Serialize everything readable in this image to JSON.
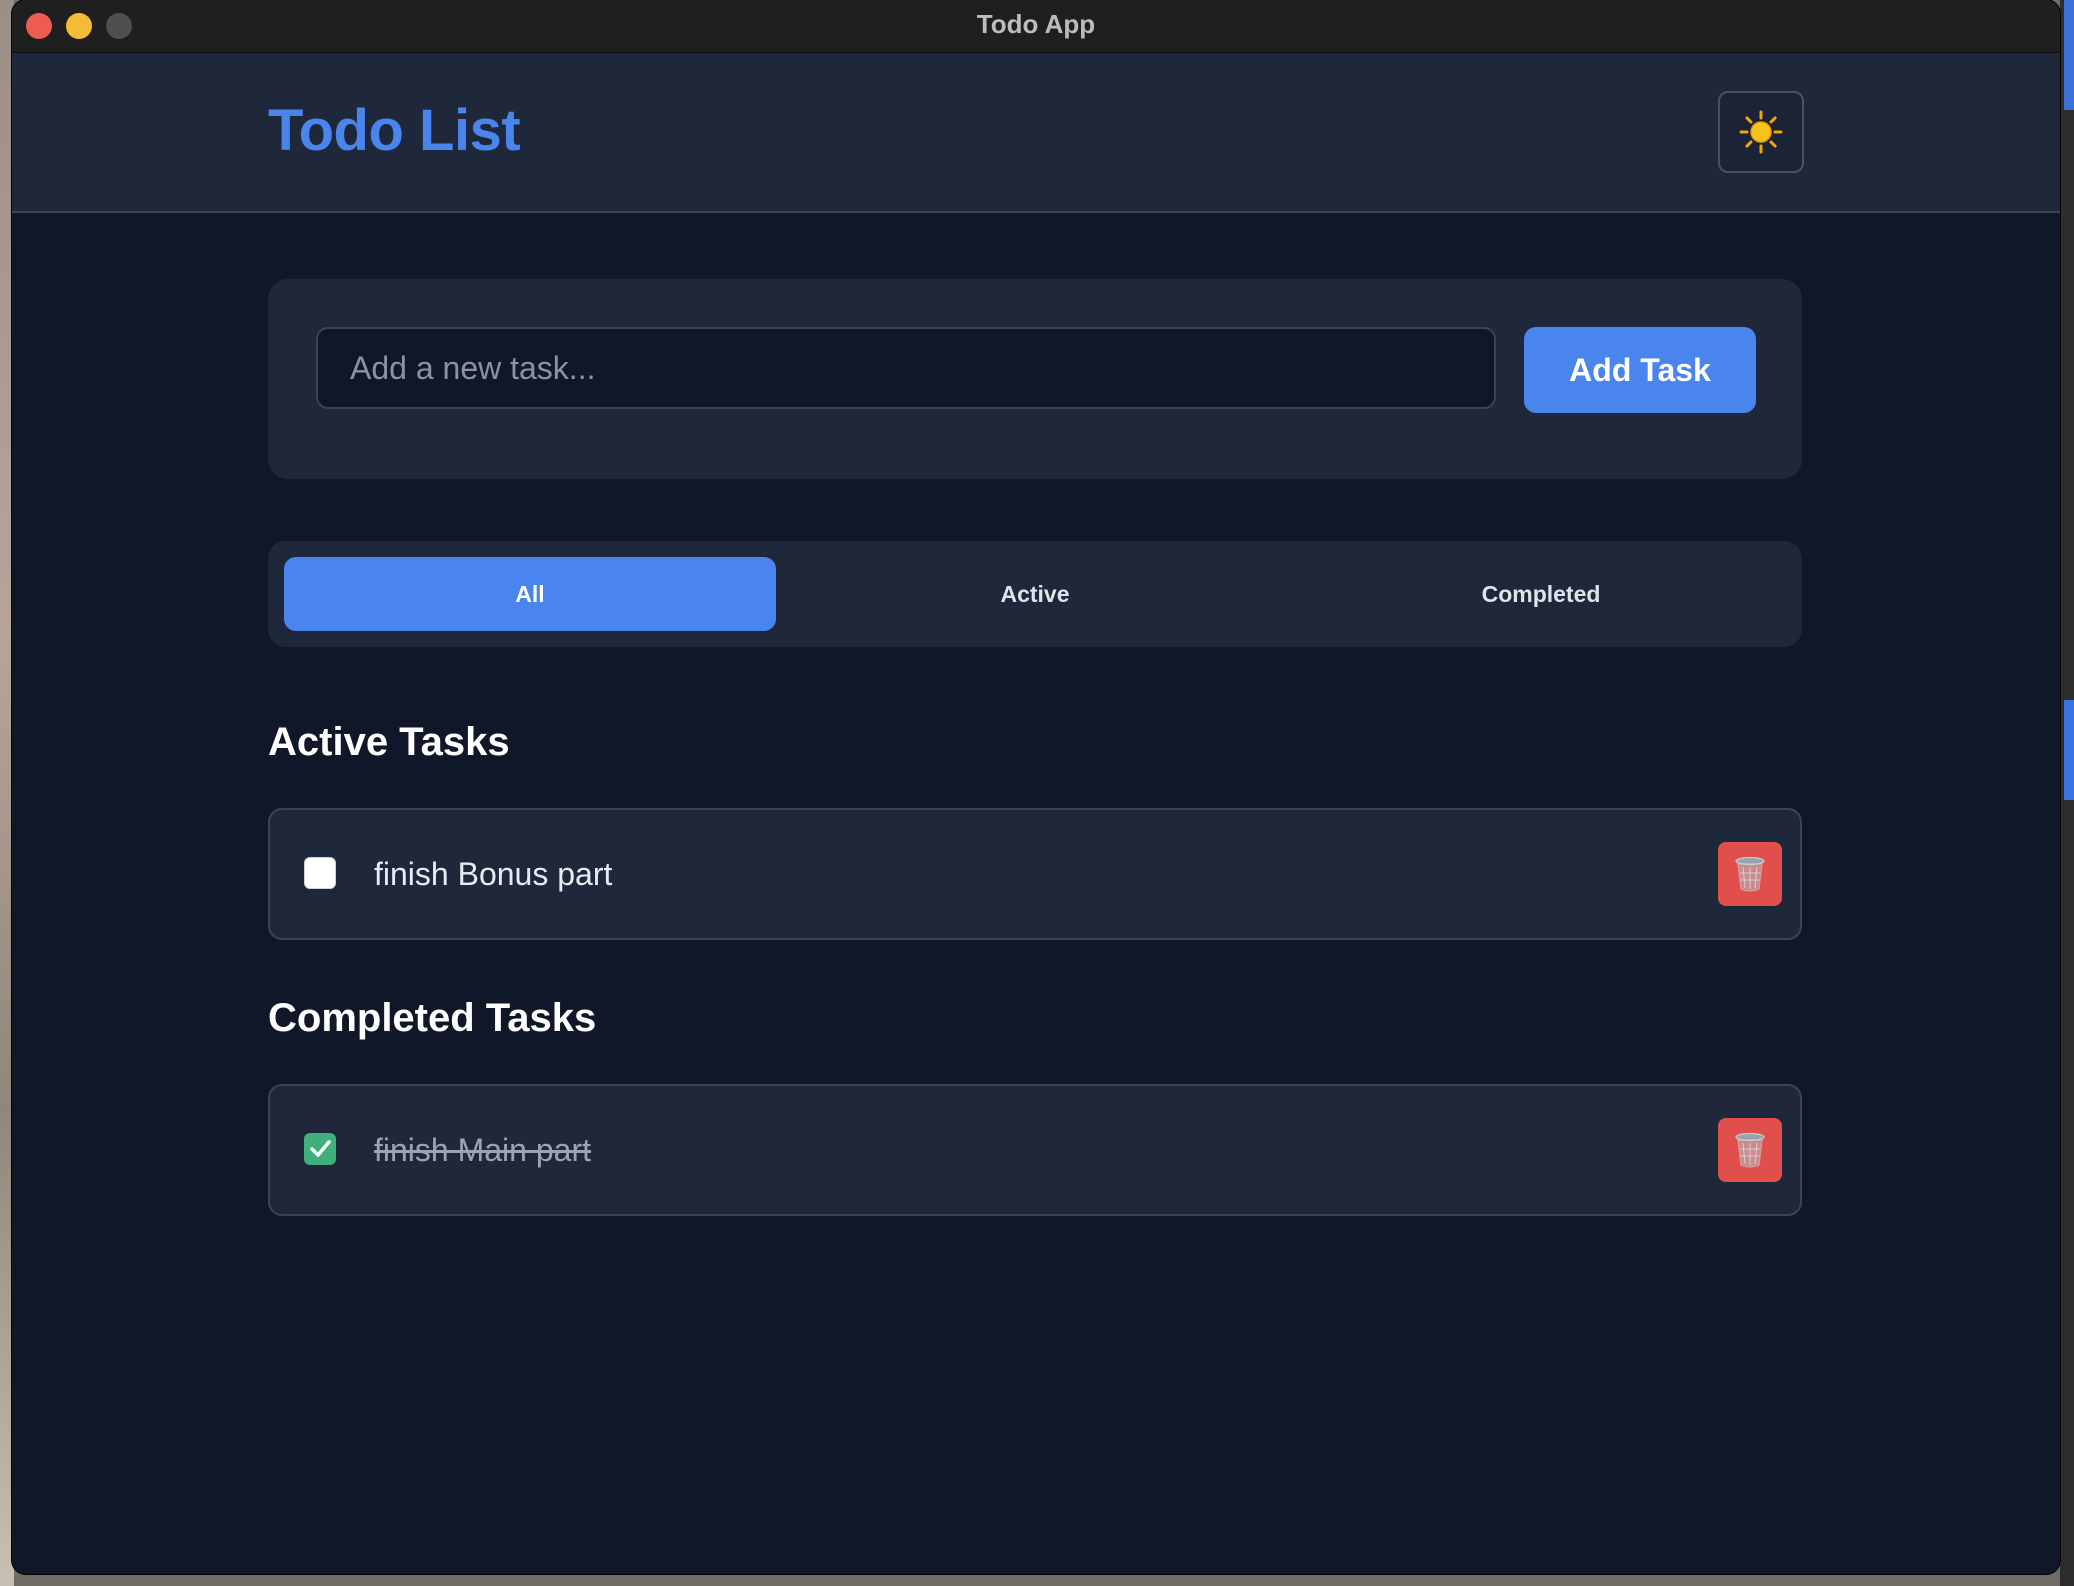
{
  "window": {
    "title": "Todo App"
  },
  "header": {
    "title": "Todo List",
    "theme_icon": "sun-icon"
  },
  "add_task": {
    "placeholder": "Add a new task...",
    "value": "",
    "button_label": "Add Task"
  },
  "filters": {
    "tabs": [
      {
        "label": "All",
        "selected": true
      },
      {
        "label": "Active",
        "selected": false
      },
      {
        "label": "Completed",
        "selected": false
      }
    ]
  },
  "sections": {
    "active": {
      "title": "Active Tasks",
      "tasks": [
        {
          "text": "finish Bonus part",
          "completed": false
        }
      ]
    },
    "completed": {
      "title": "Completed Tasks",
      "tasks": [
        {
          "text": "finish Main part",
          "completed": true
        }
      ]
    }
  },
  "colors": {
    "accent": "#4a84ed",
    "background": "#101729",
    "panel": "#1f283b",
    "delete": "#e04f4b",
    "check": "#3fb07c"
  }
}
